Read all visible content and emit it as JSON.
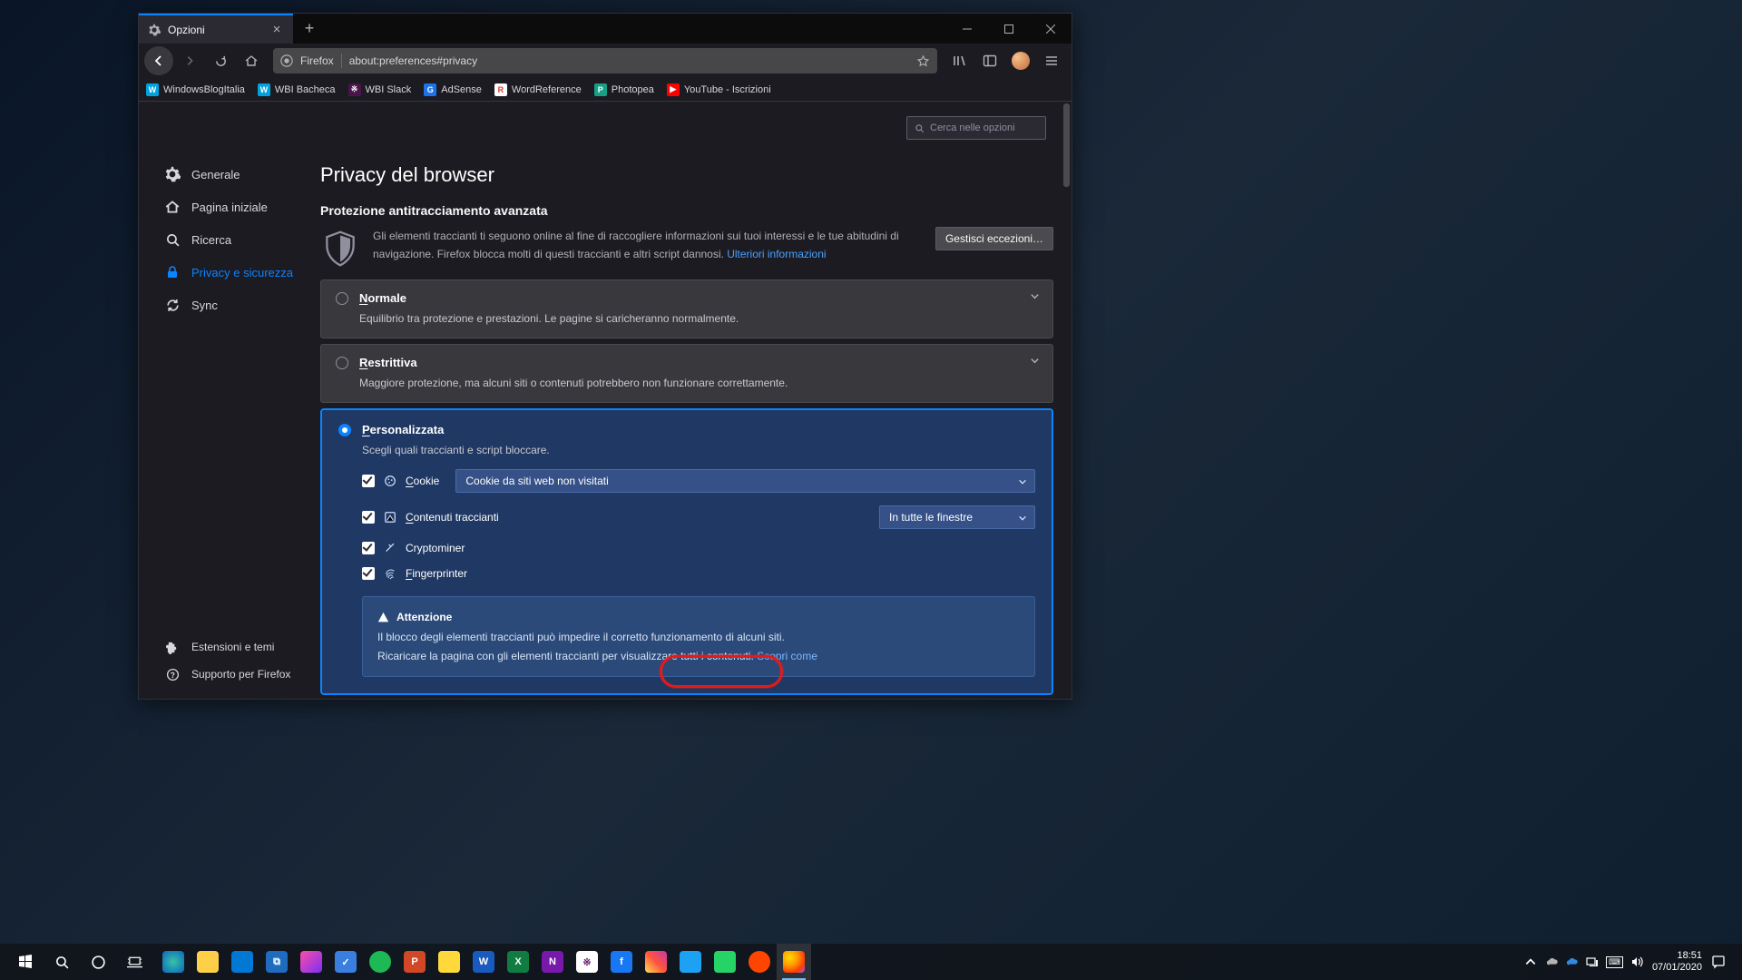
{
  "tab": {
    "title": "Opzioni"
  },
  "url": {
    "label": "Firefox",
    "address": "about:preferences#privacy"
  },
  "bookmarks": [
    {
      "name": "WindowsBlogItalia",
      "color": "#00a3e0"
    },
    {
      "name": "WBI Bacheca",
      "color": "#00a3e0"
    },
    {
      "name": "WBI Slack",
      "color": "#611f69"
    },
    {
      "name": "AdSense",
      "color": "#1a73e8"
    },
    {
      "name": "WordReference",
      "color": "#d93a2b"
    },
    {
      "name": "Photopea",
      "color": "#18a086"
    },
    {
      "name": "YouTube - Iscrizioni",
      "color": "#ff0000"
    }
  ],
  "search": {
    "placeholder": "Cerca nelle opzioni"
  },
  "sidebar": {
    "items": [
      {
        "label": "Generale"
      },
      {
        "label": "Pagina iniziale"
      },
      {
        "label": "Ricerca"
      },
      {
        "label": "Privacy e sicurezza"
      },
      {
        "label": "Sync"
      }
    ],
    "bottom": [
      {
        "label": "Estensioni e temi"
      },
      {
        "label": "Supporto per Firefox"
      }
    ]
  },
  "page": {
    "title": "Privacy del browser",
    "section": "Protezione antitracciamento avanzata",
    "intro1": "Gli elementi traccianti ti seguono online al fine di raccogliere informazioni sui tuoi interessi e le tue abitudini di navigazione. Firefox blocca molti di questi traccianti e altri script dannosi.  ",
    "intro_link": "Ulteriori informazioni",
    "manage": "Gestisci eccezioni…"
  },
  "panels": {
    "normal": {
      "title": "Normale",
      "desc": "Equilibrio tra protezione e prestazioni. Le pagine si caricheranno normalmente."
    },
    "strict": {
      "title": "Restrittiva",
      "desc": "Maggiore protezione, ma alcuni siti o contenuti potrebbero non funzionare correttamente."
    },
    "custom": {
      "title": "Personalizzata",
      "desc": "Scegli quali traccianti e script bloccare.",
      "cookie_label": "Cookie",
      "cookie_select": "Cookie da siti web non visitati",
      "content_label": "Contenuti traccianti",
      "content_select": "In tutte le finestre",
      "crypto_label": "Cryptominer",
      "finger_label": "Fingerprinter"
    }
  },
  "warn": {
    "title": "Attenzione",
    "line1": "Il blocco degli elementi traccianti può impedire il corretto funzionamento di alcuni siti.",
    "line2": "Ricaricare la pagina con gli elementi traccianti per visualizzare tutti i contenuti.  ",
    "link": "Scopri come"
  },
  "taskbar": {
    "time": "18:51",
    "date": "07/01/2020"
  }
}
